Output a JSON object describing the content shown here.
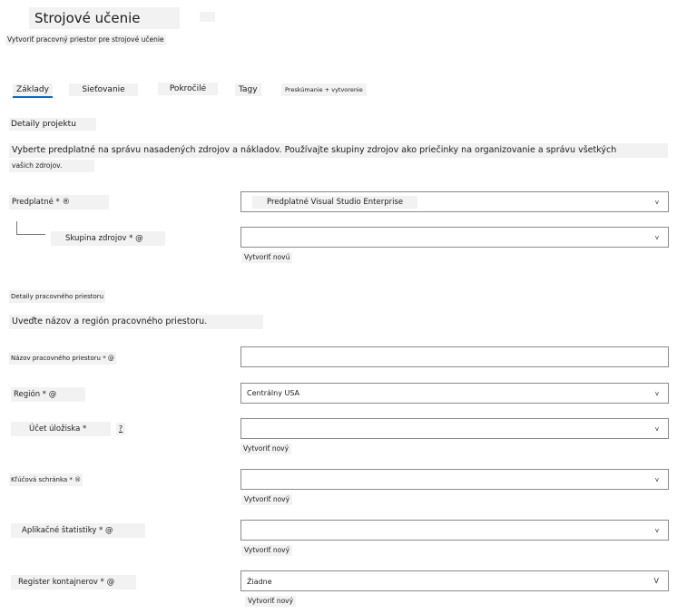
{
  "header": {
    "title": "Strojové učenie",
    "subtitle": "Vytvoriť pracovný priestor pre strojové učenie"
  },
  "tabs": [
    {
      "label": "Základy",
      "active": true
    },
    {
      "label": "Sieťovanie",
      "active": false
    },
    {
      "label": "Pokročilé",
      "active": false
    },
    {
      "label": "Tagy",
      "active": false
    },
    {
      "label": "Preskúmanie + vytvorenie",
      "active": false
    }
  ],
  "project": {
    "heading": "Detaily projektu",
    "description_line1": "Vyberte predplatné na správu nasadených zdrojov a nákladov. Používajte skupiny zdrojov ako priečinky na organizovanie a správu všetkých",
    "description_line2": "vašich zdrojov.",
    "subscription": {
      "label": "Predplatné * ®",
      "value": "Predplatné Visual Studio Enterprise"
    },
    "resource_group": {
      "label": "Skupina zdrojov * @",
      "value": "",
      "create_new": "Vytvoriť novú"
    }
  },
  "workspace": {
    "heading": "Detaily pracovného priestoru",
    "description": "Uveďte názov a región pracovného priestoru.",
    "name": {
      "label": "Názov pracovného priestoru * @",
      "value": ""
    },
    "region": {
      "label": "Región * @",
      "value": "Centrálny USA"
    },
    "storage": {
      "label": "Účet úložiska *",
      "help": "?",
      "value": "",
      "create_new": "Vytvoriť nový"
    },
    "key_vault": {
      "label": "Kľúčová schránka * ®",
      "value": "",
      "create_new": "Vytvoriť nový"
    },
    "app_insights": {
      "label": "Aplikačné štatistiky * @",
      "value": "",
      "create_new": "Vytvoriť nový"
    },
    "container_registry": {
      "label": "Register kontajnerov * @",
      "value": "Žiadne",
      "create_new": "Vytvoriť nový"
    }
  },
  "icons": {
    "chevron": "v",
    "chevron_last": "V"
  },
  "colors": {
    "accent": "#0f6cbd",
    "field_border": "#8a8a8a",
    "label_bg": "#f2f2f2"
  }
}
